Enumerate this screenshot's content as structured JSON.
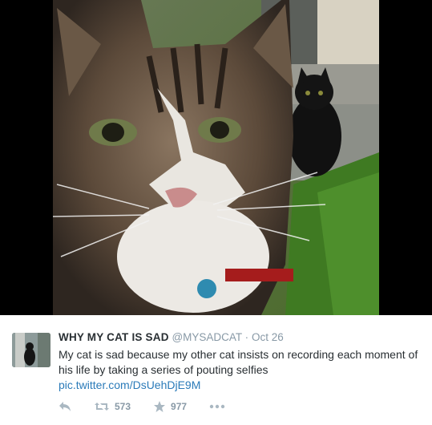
{
  "tweet": {
    "name": "WHY MY CAT IS SAD",
    "handle": "@MYSADCAT",
    "separator": "·",
    "date": "Oct 26",
    "text": "My cat is sad because my other cat insists on recording each moment of his life by taking a series of pouting selfies",
    "link": "pic.twitter.com/DsUehDjE9M"
  },
  "actions": {
    "reply_icon": "reply-icon",
    "retweet_icon": "retweet-icon",
    "retweet_count": "573",
    "favorite_icon": "star-icon",
    "favorite_count": "977",
    "more_icon": "more-dots-icon"
  },
  "colors": {
    "name": "#292f33",
    "meta": "#8899a6",
    "link": "#2b7bb9",
    "media_background": "#000000"
  }
}
